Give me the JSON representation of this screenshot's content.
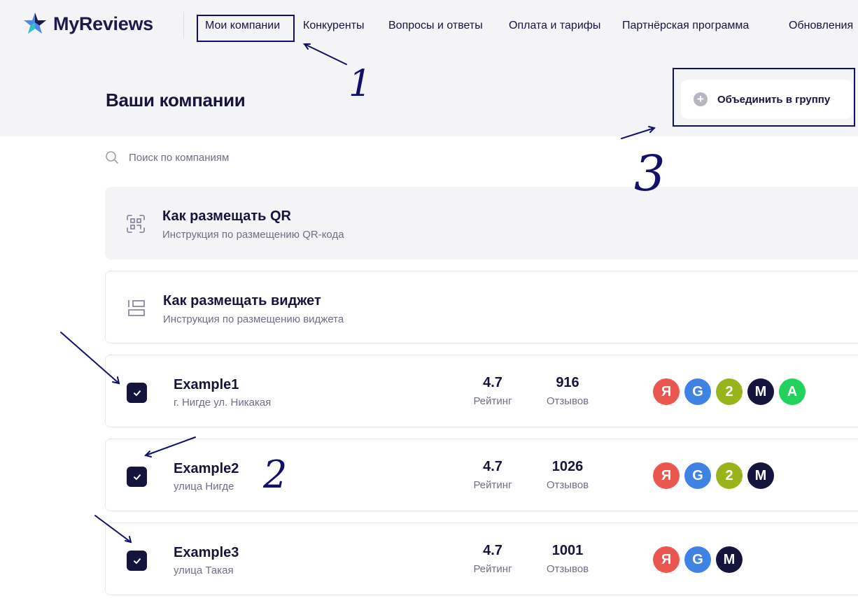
{
  "header": {
    "logo_text": "MyReviews",
    "nav": [
      "Мои компании",
      "Конкуренты",
      "Вопросы и ответы",
      "Оплата и тарифы",
      "Партнёрская программа",
      "Обновления"
    ],
    "active_nav_index": 0
  },
  "page": {
    "title": "Ваши компании",
    "merge_button_label": "Объединить в группу",
    "search_placeholder": "Поиск по компаниям"
  },
  "info_cards": [
    {
      "icon": "qr-code-icon",
      "title": "Как размещать QR",
      "subtitle": "Инструкция по размещению QR-кода"
    },
    {
      "icon": "widget-layout-icon",
      "title": "Как размещать виджет",
      "subtitle": "Инструкция по размещению виджета"
    }
  ],
  "companies": [
    {
      "name": "Example1",
      "address": "г. Нигде ул. Никакая",
      "rating": "4.7",
      "rating_label": "Рейтинг",
      "reviews": "916",
      "reviews_label": "Отзывов",
      "checked": true
    },
    {
      "name": "Example2",
      "address": "улица Нигде",
      "rating": "4.7",
      "rating_label": "Рейтинг",
      "reviews": "1026",
      "reviews_label": "Отзывов",
      "checked": true
    },
    {
      "name": "Example3",
      "address": "улица Такая",
      "rating": "4.7",
      "rating_label": "Рейтинг",
      "reviews": "1001",
      "reviews_label": "Отзывов",
      "checked": true
    }
  ],
  "badges": {
    "c0": [
      {
        "letter": "Я",
        "color": "#e9574f"
      },
      {
        "letter": "G",
        "color": "#3e82e4"
      },
      {
        "letter": "2",
        "color": "#99b41a"
      },
      {
        "letter": "M",
        "color": "#14143c"
      },
      {
        "letter": "A",
        "color": "#23d25a"
      }
    ],
    "c1": [
      {
        "letter": "Я",
        "color": "#e9574f"
      },
      {
        "letter": "G",
        "color": "#3e82e4"
      },
      {
        "letter": "2",
        "color": "#99b41a"
      },
      {
        "letter": "M",
        "color": "#14143c"
      }
    ],
    "c2": [
      {
        "letter": "Я",
        "color": "#e9574f"
      },
      {
        "letter": "G",
        "color": "#3e82e4"
      },
      {
        "letter": "M",
        "color": "#14143c"
      }
    ]
  },
  "annotations": {
    "n1": "1",
    "n2": "2",
    "n3": "3",
    "color": "#10106a"
  },
  "colors": {
    "brand_dark": "#14143c",
    "muted": "#6e6e86",
    "header_bg": "#f4f4f6"
  }
}
